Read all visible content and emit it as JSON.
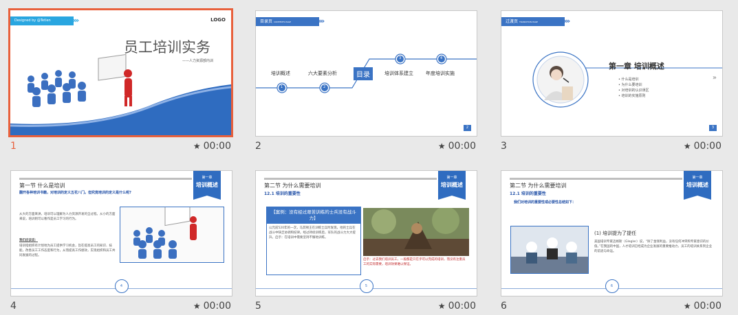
{
  "slides": [
    {
      "number": "1",
      "duration": "00:00",
      "tag": "Designed by @Tetlen",
      "logo": "LOGO",
      "title": "员工培训实务",
      "subtitle": "——人力资源部内训"
    },
    {
      "number": "2",
      "duration": "00:00",
      "tag": "目录页",
      "tag_en": "CONTENTS PAGE",
      "center": "目录",
      "items": [
        "培训概述",
        "六大要素分析",
        "培训体系建立",
        "年度培训实施"
      ],
      "nums": [
        "1",
        "2",
        "3",
        "4"
      ],
      "page": "2"
    },
    {
      "number": "3",
      "duration": "00:00",
      "tag": "过渡页",
      "tag_en": "TRANSITION PAGE",
      "chapter": "第一章  培训概述",
      "bullets": [
        "什么是培训",
        "为什么要培训",
        "对培训的认识误区",
        "培训的实施原则"
      ],
      "page": "3"
    },
    {
      "number": "4",
      "duration": "00:00",
      "ribbon_a": "第一章",
      "ribbon_b": "培训概述",
      "section": "第一节  什么是培训",
      "subtitle": "翻开各种培训书籍，对培训的定义五花八门。但究竟培训的定义是什么呢?",
      "para1": "从大的方面来讲，培训可以理解为人力资源开发的全过程。从小的方面来说，培训则可以看作是员工学习的行为。",
      "para2_head": "我们应该说：",
      "para2": "培训指组织有计划地为员工提供学习机会，旨在提高员工的知识、技能，改善员工工作态度和行为，从而提高工作绩效，实现组织和员工共同发展的过程。",
      "page": "4"
    },
    {
      "number": "5",
      "duration": "00:00",
      "ribbon_a": "第一章",
      "ribbon_b": "培训概述",
      "section": "第二节  为什么需要培训",
      "subsection": "12.1 培训的重要性",
      "case_title": "【案例：没有经过艰苦训练的士兵没有战斗力】",
      "case_text": "公元前520年的一次，马其顿王在训练士兵时发现，他的士兵在战斗中缺乏协调和纪律。经过持续训练后，军队的战斗力大大提升。启示：在培训中需要坚持不懈地训练。",
      "quote": "启示：过去我们培训员工，一般都是只在乎可以完成的培训，而没有注重员工的实际需要，培训效果难以保证。",
      "page": "5"
    },
    {
      "number": "6",
      "duration": "00:00",
      "ribbon_a": "第一章",
      "ribbon_b": "培训概述",
      "section": "第二节  为什么需要培训",
      "subsection": "12.1 培训的重要性",
      "lead": "我们对培训的重要性或必要性总结如下：",
      "point": "(1) 培训提为了提任",
      "text": "美国培训专家迈格斯（Glegler）说，“除了金钱利益，没有任何冲突和专家意识的价值。”在我国的中国，人才培训已经成为企业发展的重要推动力，员工的培训关系到企业的前途与命运。",
      "page": "6"
    }
  ]
}
